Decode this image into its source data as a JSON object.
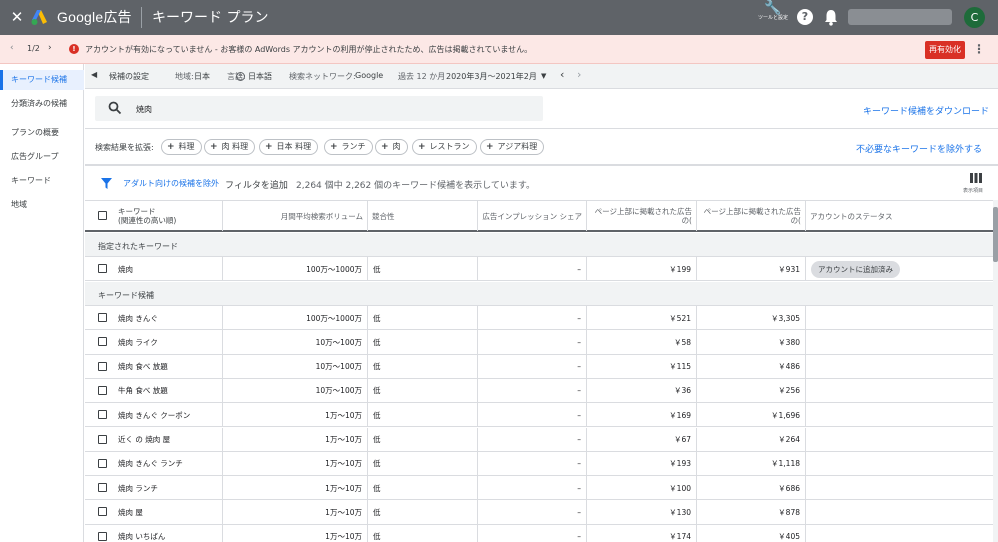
{
  "app": {
    "brand": "Google広告",
    "page_title": "キーワード プラン",
    "tools_label": "ツールと設定",
    "avatar_letter": "C"
  },
  "alert": {
    "pager": "1/2",
    "message": "アカウントが有効になっていません - お客様の AdWords アカウントの利用が停止されたため、広告は掲載されていません。",
    "reactivate_label": "再有効化"
  },
  "sidebar": {
    "items": [
      {
        "label": "キーワード候補",
        "active": true
      },
      {
        "label": "分類済みの候補"
      },
      {
        "label": "プランの概要"
      },
      {
        "label": "広告グループ"
      },
      {
        "label": "キーワード"
      },
      {
        "label": "地域"
      }
    ]
  },
  "settings": {
    "candidate_settings": "候補の設定",
    "region_label": "地域:",
    "region_value": "日本",
    "language_label": "言語:",
    "language_value": "日本語",
    "network_label": "検索ネットワーク:",
    "network_value": "Google",
    "period_label": "過去 12 か月",
    "period_value": "2020年3月～2021年2月"
  },
  "search": {
    "value": "焼肉",
    "download_label": "キーワード候補をダウンロード"
  },
  "broaden": {
    "label": "検索結果を拡張:",
    "chips": [
      "料理",
      "肉 料理",
      "日本 料理",
      "ランチ",
      "肉",
      "レストラン",
      "アジア料理"
    ],
    "exclude_label": "不必要なキーワードを除外する"
  },
  "filter": {
    "adult_label": "アダルト向けの候補を除外",
    "add_filter_label": "フィルタを追加",
    "count_text": "2,264 個中 2,262 個のキーワード候補を表示しています。",
    "columns_label": "表示項目"
  },
  "table": {
    "headers": {
      "keyword": "キーワード",
      "keyword_sub": "(関連性の高い順)",
      "volume": "月間平均検索ボリューム",
      "competition": "競合性",
      "impression_share": "広告インプレッション シェア",
      "top_bid_low": "ページ上部に掲載された広告の(",
      "top_bid_high": "ページ上部に掲載された広告の(",
      "status": "アカウントのステータス"
    },
    "specified_section": "指定されたキーワード",
    "specified_rows": [
      {
        "keyword": "焼肉",
        "volume": "100万～1000万",
        "competition": "低",
        "share": "–",
        "low": "￥199",
        "high": "￥931",
        "status": "アカウントに追加済み"
      }
    ],
    "candidates_section": "キーワード候補",
    "rows": [
      {
        "keyword": "焼肉 きんぐ",
        "volume": "100万～1000万",
        "competition": "低",
        "share": "–",
        "low": "￥521",
        "high": "￥3,305"
      },
      {
        "keyword": "焼肉 ライク",
        "volume": "10万～100万",
        "competition": "低",
        "share": "–",
        "low": "￥58",
        "high": "￥380"
      },
      {
        "keyword": "焼肉 食べ 放題",
        "volume": "10万～100万",
        "competition": "低",
        "share": "–",
        "low": "￥115",
        "high": "￥486"
      },
      {
        "keyword": "牛角 食べ 放題",
        "volume": "10万～100万",
        "competition": "低",
        "share": "–",
        "low": "￥36",
        "high": "￥256"
      },
      {
        "keyword": "焼肉 きんぐ クーポン",
        "volume": "1万～10万",
        "competition": "低",
        "share": "–",
        "low": "￥169",
        "high": "￥1,696"
      },
      {
        "keyword": "近く の 焼肉 屋",
        "volume": "1万～10万",
        "competition": "低",
        "share": "–",
        "low": "￥67",
        "high": "￥264"
      },
      {
        "keyword": "焼肉 きんぐ ランチ",
        "volume": "1万～10万",
        "competition": "低",
        "share": "–",
        "low": "￥193",
        "high": "￥1,118"
      },
      {
        "keyword": "焼肉 ランチ",
        "volume": "1万～10万",
        "competition": "低",
        "share": "–",
        "low": "￥100",
        "high": "￥686"
      },
      {
        "keyword": "焼肉 屋",
        "volume": "1万～10万",
        "competition": "低",
        "share": "–",
        "low": "￥130",
        "high": "￥878"
      },
      {
        "keyword": "焼肉 いちばん",
        "volume": "1万～10万",
        "competition": "低",
        "share": "–",
        "low": "￥174",
        "high": "￥405"
      }
    ]
  },
  "colors": {
    "topbar": "#5f6368",
    "accent": "#1a73e8",
    "alert_bg": "#fce8e6",
    "danger": "#d93025"
  }
}
